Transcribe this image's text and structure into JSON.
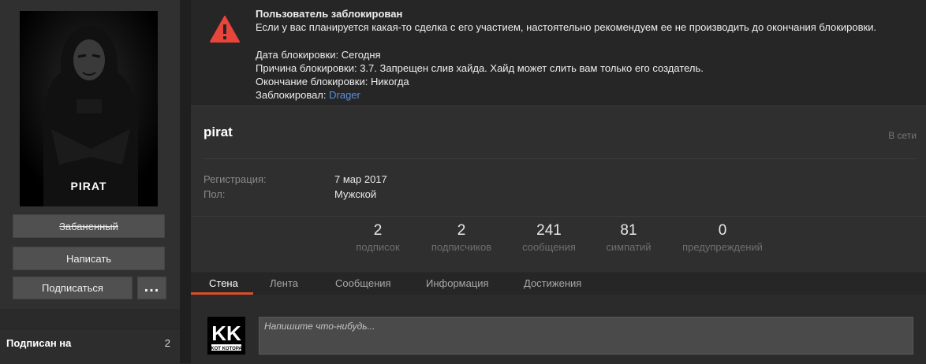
{
  "sidebar": {
    "avatar_caption": "PIRAT",
    "banned_label": "Забаненный",
    "write_label": "Написать",
    "subscribe_label": "Подписаться",
    "more_label": "...",
    "subscribed_label": "Подписан на",
    "subscribed_count": "2"
  },
  "alert": {
    "title": "Пользователь заблокирован",
    "message": "Если у вас планируется какая-то сделка с его участием, настоятельно рекомендуем ее не производить до окончания блокировки.",
    "date_line": "Дата блокировки: Сегодня",
    "reason_line": "Причина блокировки: 3.7. Запрещен слив хайда. Хайд может слить вам только его создатель.",
    "end_line": "Окончание блокировки: Никогда",
    "blocked_by_label": "Заблокировал: ",
    "blocked_by_user": "Drager",
    "icon_color": "#e8453c"
  },
  "profile": {
    "username": "pirat",
    "status": "В сети",
    "fields": [
      {
        "key": "Регистрация:",
        "value": "7 мар 2017"
      },
      {
        "key": "Пол:",
        "value": "Мужской"
      }
    ],
    "stats": [
      {
        "number": "2",
        "label": "подписок"
      },
      {
        "number": "2",
        "label": "подписчиков"
      },
      {
        "number": "241",
        "label": "сообщения"
      },
      {
        "number": "81",
        "label": "симпатий"
      },
      {
        "number": "0",
        "label": "предупреждений"
      }
    ]
  },
  "tabs": [
    {
      "label": "Стена",
      "active": true
    },
    {
      "label": "Лента"
    },
    {
      "label": "Сообщения"
    },
    {
      "label": "Информация"
    },
    {
      "label": "Достижения"
    }
  ],
  "wall": {
    "avatar_text": "KK",
    "avatar_subtext": "KOT KOTOPA",
    "input_placeholder": "Напишите что-нибудь..."
  },
  "colors": {
    "accent": "#d94f2b",
    "link": "#5b8fe3"
  }
}
